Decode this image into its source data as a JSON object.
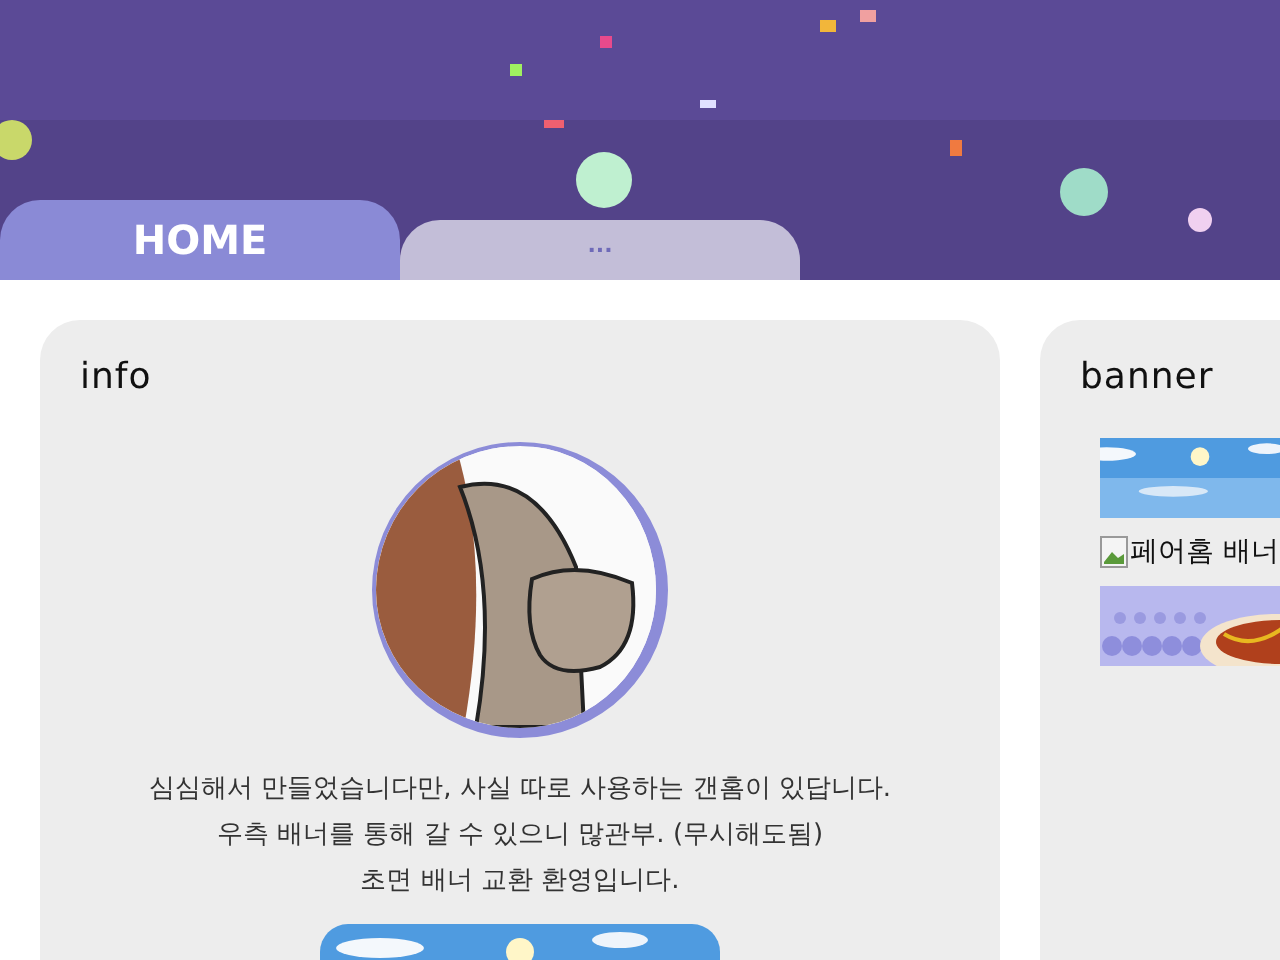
{
  "tabs": [
    {
      "label": "HOME",
      "selected": true
    },
    {
      "label": "...",
      "selected": false
    }
  ],
  "info": {
    "title": "info",
    "lines": [
      "심심해서 만들었습니다만, 사실 따로 사용하는 갠홈이 있답니다.",
      "우측 배너를 통해 갈 수 있으니 많관부. (무시해도됨)",
      "초면 배너 교환 환영입니다."
    ]
  },
  "banner": {
    "title": "banner",
    "items": [
      {
        "kind": "picture"
      },
      {
        "kind": "broken",
        "alt": "페어홈 배너"
      },
      {
        "kind": "food"
      }
    ]
  }
}
